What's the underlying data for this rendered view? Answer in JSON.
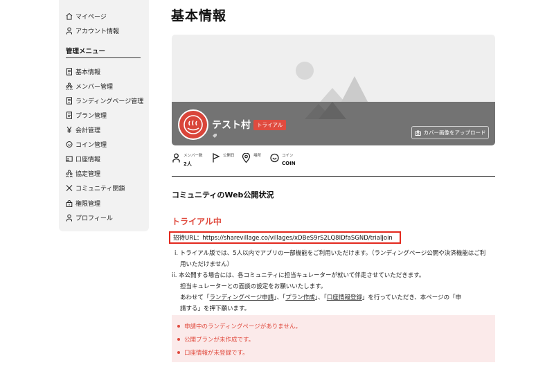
{
  "sidebar": {
    "top_items": [
      {
        "label": "マイページ",
        "icon": "home-icon"
      },
      {
        "label": "アカウント情報",
        "icon": "user-icon"
      }
    ],
    "section_title": "管理メニュー",
    "menu_items": [
      {
        "label": "基本情報",
        "icon": "document-icon"
      },
      {
        "label": "メンバー管理",
        "icon": "members-icon"
      },
      {
        "label": "ランディングページ管理",
        "icon": "document-icon"
      },
      {
        "label": "プラン管理",
        "icon": "document-icon"
      },
      {
        "label": "会計管理",
        "icon": "yen-icon"
      },
      {
        "label": "コイン管理",
        "icon": "coin-icon"
      },
      {
        "label": "口座情報",
        "icon": "bank-card-icon"
      },
      {
        "label": "協定管理",
        "icon": "members-icon"
      },
      {
        "label": "コミュニティ閉鎖",
        "icon": "close-icon"
      },
      {
        "label": "権限管理",
        "icon": "lock-icon"
      },
      {
        "label": "プロフィール",
        "icon": "user-icon"
      }
    ]
  },
  "page": {
    "title": "基本情報"
  },
  "profile": {
    "village_name": "テスト村",
    "badge": "トライアル",
    "upload_button": "カバー画像をアップロード"
  },
  "stats": [
    {
      "label": "メンバー数",
      "value": "2人",
      "icon": "member-icon"
    },
    {
      "label": "公開日",
      "value": "",
      "icon": "flag-icon"
    },
    {
      "label": "場所",
      "value": "",
      "icon": "location-pin-icon"
    },
    {
      "label": "コイン",
      "value": "COIN",
      "icon": "coin-icon"
    }
  ],
  "web_status": {
    "section_title": "コミュニティのWeb公開状況",
    "status": "トライアル中",
    "invite_url_text": "招待URL：https://sharevillage.co/villages/xDBeS9rS2LQ8IDfaSGND/trialJoin",
    "note1_line1": "i. トライアル版では、5人以内でアプリの一部機能をご利用いただけます。（ランディングページ公開や決済機能はご利",
    "note1_line2": "用いただけません）",
    "note2_line1": "ii. 本公開する場合には、各コミュニティに担当キュレーターが就いて伴走させていただきます。",
    "note2_line2": "担当キュレーターとの面談の設定をお願いいたします。",
    "note2_line3_pre": "あわせて「",
    "link_lp": "ランディングページ申請",
    "sep1": "」、「",
    "link_plan": "プラン作成",
    "sep2": "」、「",
    "link_bank": "口座情報登録",
    "note2_line3_post": "」を行っていただき、本ページの「申",
    "note2_line4": "請する」を押下願います。"
  },
  "alerts": [
    "申請中のランディングページがありません。",
    "公開プランが未作成です。",
    "口座情報が未登録です。"
  ],
  "colors": {
    "accent_red": "#e04b3f",
    "alert_bg": "#fbeaea",
    "sidebar_bg": "#f2f2f2",
    "cover_band": "#737373"
  }
}
